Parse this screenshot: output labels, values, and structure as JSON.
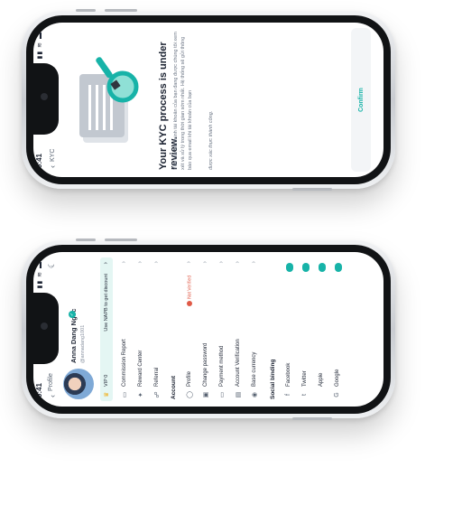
{
  "kyc_screen": {
    "status_time": "9:41",
    "status_icons": "▮▮ ≋ ▬",
    "nav_title": "KYC",
    "title": "Your KYC process is under review.",
    "description": "Yêu cầu xác minh tài khoản của bạn đang được chúng tôi xem xét và xử lý trong thời gian sớm nhất. Hệ thống sẽ gửi thông báo qua email khi tài khoản của bạn",
    "success_text": "được xác thực thành công.",
    "confirm_label": "Confirm",
    "colors": {
      "accent": "#17b3a8"
    }
  },
  "profile_screen": {
    "status_time": "9:41",
    "status_icons": "▮▮ ≋ ▬",
    "nav_title": "Profile",
    "user": {
      "name": "Anna Dang Ngoc",
      "handle": "@annadang1001"
    },
    "vip": {
      "label": "VIP 0",
      "promo": "Use NAPB to get discount"
    },
    "menu": [
      {
        "icon": "commission-icon",
        "glyph": "▭",
        "label": "Commission Report"
      },
      {
        "icon": "reward-icon",
        "glyph": "✦",
        "label": "Reward Center"
      },
      {
        "icon": "referral-icon",
        "glyph": "☍",
        "label": "Referral"
      }
    ],
    "account_section": "Account",
    "account_menu": [
      {
        "icon": "profile-icon",
        "glyph": "◯",
        "label": "Profile",
        "badge": "Not Verified"
      },
      {
        "icon": "lock-icon",
        "glyph": "▣",
        "label": "Change password"
      },
      {
        "icon": "card-icon",
        "glyph": "▭",
        "label": "Payment method"
      },
      {
        "icon": "id-icon",
        "glyph": "▤",
        "label": "Account Verification"
      },
      {
        "icon": "currency-icon",
        "glyph": "◉",
        "label": "Base currency"
      }
    ],
    "social_section": "Social binding",
    "social_menu": [
      {
        "icon": "facebook-icon",
        "glyph": "f",
        "label": "Facebook"
      },
      {
        "icon": "twitter-icon",
        "glyph": "t",
        "label": "Twitter"
      },
      {
        "icon": "apple-icon",
        "glyph": "",
        "label": "Apple"
      },
      {
        "icon": "google-icon",
        "glyph": "G",
        "label": "Google"
      }
    ]
  }
}
